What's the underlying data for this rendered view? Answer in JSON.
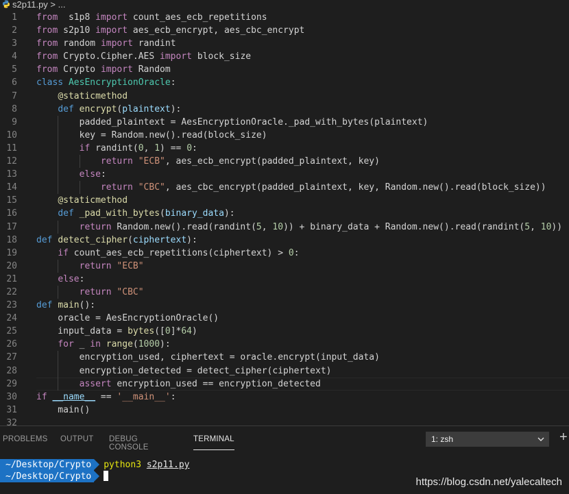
{
  "breadcrumb": {
    "file": "s2p11.py",
    "sep": " > ",
    "rest": "..."
  },
  "editor": {
    "lines": [
      {
        "n": "1",
        "tokens": [
          [
            "kw",
            "from"
          ],
          [
            "",
            "  s1p8 "
          ],
          [
            "kw",
            "import"
          ],
          [
            "",
            " count_aes_ecb_repetitions"
          ]
        ]
      },
      {
        "n": "2",
        "tokens": [
          [
            "kw",
            "from"
          ],
          [
            "",
            "",
            " "
          ],
          [
            "",
            "s2p10 "
          ],
          [
            "kw",
            "import"
          ],
          [
            "",
            " aes_ecb_encrypt, aes_cbc_encrypt"
          ]
        ]
      },
      {
        "n": "3",
        "tokens": [
          [
            "kw",
            "from"
          ],
          [
            "",
            " random "
          ],
          [
            "kw",
            "import"
          ],
          [
            "",
            " randint"
          ]
        ]
      },
      {
        "n": "4",
        "tokens": [
          [
            "kw",
            "from"
          ],
          [
            "",
            " Crypto.Cipher.AES "
          ],
          [
            "kw",
            "import"
          ],
          [
            "",
            " block_size"
          ]
        ]
      },
      {
        "n": "5",
        "tokens": [
          [
            "kw",
            "from"
          ],
          [
            "",
            " Crypto "
          ],
          [
            "kw",
            "import"
          ],
          [
            "",
            " Random"
          ]
        ]
      },
      {
        "n": "6",
        "tokens": [
          [
            "st",
            "class"
          ],
          [
            "",
            " "
          ],
          [
            "cls",
            "AesEncryptionOracle"
          ],
          [
            "",
            ":"
          ]
        ]
      },
      {
        "n": "7",
        "tokens": [
          [
            "",
            "    "
          ],
          [
            "dec",
            "@staticmethod"
          ]
        ]
      },
      {
        "n": "8",
        "tokens": [
          [
            "",
            "    "
          ],
          [
            "st",
            "def"
          ],
          [
            "",
            " "
          ],
          [
            "fn",
            "encrypt"
          ],
          [
            "",
            "("
          ],
          [
            "var",
            "plaintext"
          ],
          [
            "",
            "):"
          ]
        ]
      },
      {
        "n": "9",
        "tokens": [
          [
            "",
            "        padded_plaintext = AesEncryptionOracle._pad_with_bytes(plaintext)"
          ]
        ]
      },
      {
        "n": "10",
        "tokens": [
          [
            "",
            "        key = Random.new().read(block_size)"
          ]
        ]
      },
      {
        "n": "11",
        "tokens": [
          [
            "",
            "        "
          ],
          [
            "kw",
            "if"
          ],
          [
            "",
            " randint("
          ],
          [
            "num",
            "0"
          ],
          [
            "",
            ", "
          ],
          [
            "num",
            "1"
          ],
          [
            "",
            ") == "
          ],
          [
            "num",
            "0"
          ],
          [
            "",
            ":"
          ]
        ]
      },
      {
        "n": "12",
        "tokens": [
          [
            "",
            "            "
          ],
          [
            "kw",
            "return"
          ],
          [
            "",
            " "
          ],
          [
            "str",
            "\"ECB\""
          ],
          [
            "",
            ", aes_ecb_encrypt(padded_plaintext, key)"
          ]
        ]
      },
      {
        "n": "13",
        "tokens": [
          [
            "",
            "        "
          ],
          [
            "kw",
            "else"
          ],
          [
            "",
            ":"
          ]
        ]
      },
      {
        "n": "14",
        "tokens": [
          [
            "",
            "            "
          ],
          [
            "kw",
            "return"
          ],
          [
            "",
            " "
          ],
          [
            "str",
            "\"CBC\""
          ],
          [
            "",
            ", aes_cbc_encrypt(padded_plaintext, key, Random.new().read(block_size))"
          ]
        ]
      },
      {
        "n": "15",
        "tokens": [
          [
            "",
            "    "
          ],
          [
            "dec",
            "@staticmethod"
          ]
        ]
      },
      {
        "n": "16",
        "tokens": [
          [
            "",
            "    "
          ],
          [
            "st",
            "def"
          ],
          [
            "",
            " "
          ],
          [
            "fn",
            "_pad_with_bytes"
          ],
          [
            "",
            "("
          ],
          [
            "var",
            "binary_data"
          ],
          [
            "",
            "):"
          ]
        ]
      },
      {
        "n": "17",
        "tokens": [
          [
            "",
            "        "
          ],
          [
            "kw",
            "return"
          ],
          [
            "",
            " Random.new().read(randint("
          ],
          [
            "num",
            "5"
          ],
          [
            "",
            ", "
          ],
          [
            "num",
            "10"
          ],
          [
            "",
            ")) + binary_data + Random.new().read(randint("
          ],
          [
            "num",
            "5"
          ],
          [
            "",
            ", "
          ],
          [
            "num",
            "10"
          ],
          [
            "",
            "))"
          ]
        ]
      },
      {
        "n": "18",
        "tokens": [
          [
            "st",
            "def"
          ],
          [
            "",
            " "
          ],
          [
            "fn",
            "detect_cipher"
          ],
          [
            "",
            "("
          ],
          [
            "var",
            "ciphertext"
          ],
          [
            "",
            "):"
          ]
        ]
      },
      {
        "n": "19",
        "tokens": [
          [
            "",
            "    "
          ],
          [
            "kw",
            "if"
          ],
          [
            "",
            " count_aes_ecb_repetitions(ciphertext) > "
          ],
          [
            "num",
            "0"
          ],
          [
            "",
            ":"
          ]
        ]
      },
      {
        "n": "20",
        "tokens": [
          [
            "",
            "        "
          ],
          [
            "kw",
            "return"
          ],
          [
            "",
            " "
          ],
          [
            "str",
            "\"ECB\""
          ]
        ]
      },
      {
        "n": "21",
        "tokens": [
          [
            "",
            "    "
          ],
          [
            "kw",
            "else"
          ],
          [
            "",
            ":"
          ]
        ]
      },
      {
        "n": "22",
        "tokens": [
          [
            "",
            "        "
          ],
          [
            "kw",
            "return"
          ],
          [
            "",
            " "
          ],
          [
            "str",
            "\"CBC\""
          ]
        ]
      },
      {
        "n": "23",
        "tokens": [
          [
            "st",
            "def"
          ],
          [
            "",
            " "
          ],
          [
            "fn",
            "main"
          ],
          [
            "",
            "():"
          ]
        ]
      },
      {
        "n": "24",
        "tokens": [
          [
            "",
            "    oracle = AesEncryptionOracle()"
          ]
        ]
      },
      {
        "n": "25",
        "tokens": [
          [
            "",
            "    input_data = "
          ],
          [
            "fn",
            "bytes"
          ],
          [
            "",
            "(["
          ],
          [
            "num",
            "0"
          ],
          [
            "",
            "]*"
          ],
          [
            "num",
            "64"
          ],
          [
            "",
            ")"
          ]
        ]
      },
      {
        "n": "26",
        "tokens": [
          [
            "",
            "    "
          ],
          [
            "kw",
            "for"
          ],
          [
            "",
            " _ "
          ],
          [
            "kw",
            "in"
          ],
          [
            "",
            " "
          ],
          [
            "fn",
            "range"
          ],
          [
            "",
            "("
          ],
          [
            "num",
            "1000"
          ],
          [
            "",
            "):"
          ]
        ]
      },
      {
        "n": "27",
        "tokens": [
          [
            "",
            "        encryption_used, ciphertext = oracle.encrypt(input_data)"
          ]
        ]
      },
      {
        "n": "28",
        "tokens": [
          [
            "",
            "        encryption_detected = detect_cipher(ciphertext)"
          ]
        ]
      },
      {
        "n": "29",
        "tokens": [
          [
            "",
            "        "
          ],
          [
            "kw",
            "assert"
          ],
          [
            "",
            " encryption_used == encryption_detected"
          ]
        ]
      },
      {
        "n": "30",
        "tokens": [
          [
            "kw",
            "if"
          ],
          [
            "",
            " "
          ],
          [
            "var ul",
            "__name__"
          ],
          [
            "",
            " == "
          ],
          [
            "str",
            "'__main__'"
          ],
          [
            "",
            ":"
          ]
        ]
      },
      {
        "n": "31",
        "tokens": [
          [
            "",
            "    main()"
          ]
        ]
      },
      {
        "n": "32",
        "tokens": [
          [
            "",
            ""
          ]
        ]
      }
    ]
  },
  "panel": {
    "tabs": [
      "PROBLEMS",
      "OUTPUT",
      "DEBUG CONSOLE",
      "TERMINAL"
    ],
    "active_tab": "TERMINAL",
    "terminal_select": "1: zsh",
    "add_label": "+"
  },
  "terminal": {
    "lines": [
      {
        "prompt": "~/Desktop/Crypto",
        "cmd": "python3",
        "arg": "s2p11.py"
      },
      {
        "prompt": "~/Desktop/Crypto",
        "cmd": "",
        "arg": ""
      }
    ]
  },
  "watermark": "https://blog.csdn.net/yalecaltech",
  "colors": {
    "background": "#1e1e1e",
    "keyword": "#c586c0",
    "storage": "#569cd6",
    "function": "#dcdcaa",
    "string": "#ce9178",
    "number": "#b5cea8",
    "prompt_bg": "#1d72c4"
  },
  "icons": {
    "file_icon": "python-icon",
    "select_chevron": "chevron-down-icon",
    "new_terminal": "plus-icon"
  }
}
